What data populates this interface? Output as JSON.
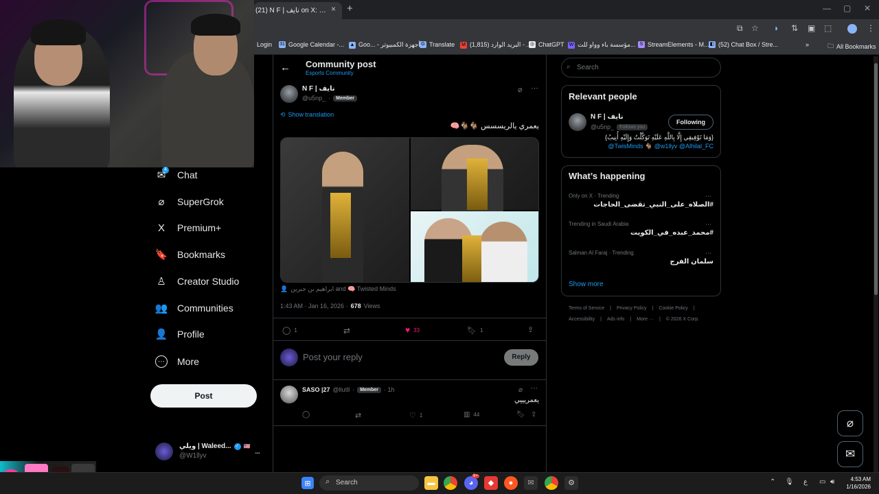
{
  "browser": {
    "tab_title": "(21) N F | نايف on X: \"الريسسس",
    "tab_close": "×",
    "new_tab": "+",
    "bookmarks": [
      {
        "label": "Login",
        "icon": ""
      },
      {
        "label": "Google Calendar -...",
        "icon": "31"
      },
      {
        "label": "Goo... - أجهزة الكمبيوتر",
        "icon": "▲"
      },
      {
        "label": "Translate",
        "icon": "G"
      },
      {
        "label": "البريد الوارد (1,815) - ...",
        "icon": "M"
      },
      {
        "label": "ChatGPT",
        "icon": "◎"
      },
      {
        "label": "مؤسسة باء وواو للت...",
        "icon": "W"
      },
      {
        "label": "StreamElements - M...",
        "icon": "S"
      },
      {
        "label": "(52) Chat Box / Stre...",
        "icon": "◧"
      }
    ],
    "more_bookmarks": "»",
    "all_bookmarks": "All Bookmarks"
  },
  "nav": {
    "chat_badge": "4",
    "items": [
      {
        "label": "Chat",
        "icon": "✉"
      },
      {
        "label": "SuperGrok",
        "icon": "⌀"
      },
      {
        "label": "Premium+",
        "icon": "X"
      },
      {
        "label": "Bookmarks",
        "icon": "🔖"
      },
      {
        "label": "Creator Studio",
        "icon": "♙"
      },
      {
        "label": "Communities",
        "icon": "👥"
      },
      {
        "label": "Profile",
        "icon": "👤"
      },
      {
        "label": "More",
        "icon": "⋯"
      }
    ],
    "post_button": "Post",
    "account": {
      "name": "ويلي | Waleed...",
      "handle": "@W1llyv",
      "more": "..."
    }
  },
  "post": {
    "header_title": "Community post",
    "header_subtitle": "Esports Community",
    "author_name": "N F | نايف",
    "author_handle": "@u5np_",
    "dot": "·",
    "member_badge": "Member",
    "show_translation": "Show translation",
    "text": "يعمري يالريسسس 🐐🐐🧠",
    "tagged": "ابراهيم بن جبرين and 🧠 Twisted Minds",
    "timestamp": "1:43 AM · Jan 16, 2026 ·",
    "views_count": "678",
    "views_label": "Views",
    "replies": "1",
    "likes": "33",
    "bookmarks": "1",
    "reply_placeholder": "Post your reply",
    "reply_button": "Reply"
  },
  "reply": {
    "name": "SASO |27",
    "handle": "@llutll",
    "badge": "Member",
    "time": "· 1h",
    "text": "يعمريييي",
    "likes": "1",
    "views": "44"
  },
  "sidebar": {
    "search_placeholder": "Search",
    "relevant_title": "Relevant people",
    "person_name": "N F | نايف",
    "person_handle": "@u5np_",
    "follows_you": "Follows you",
    "following_button": "Following",
    "bio_text": "{وَمَا تَوْفِيقِي إِلَّا بِاللَّهِ عَلَيْهِ تَوَكَّلْتُ وَإِلَيْهِ أُنِيبُ}",
    "bio_links": "@TwisMinds 🐐 @w1llyv @Alhilal_FC",
    "happening_title": "What’s happening",
    "trends": [
      {
        "meta": "Only on X · Trending",
        "name": "#الصلاه_على_النبي_تقضى_الحاجات"
      },
      {
        "meta": "Trending in Saudi Arabia",
        "name": "#محمد_عبده_في_الكويت"
      },
      {
        "meta": "Salman Al Faraj · Trending",
        "name": "سلمان الفرج"
      }
    ],
    "show_more": "Show more",
    "footer_row1": [
      "Terms of Service",
      "Privacy Policy",
      "Cookie Policy"
    ],
    "footer_row2": [
      "Accessibility",
      "Ads info",
      "More ···",
      "© 2026 X Corp."
    ]
  },
  "taskbar": {
    "search": "Search",
    "time": "4:53 AM",
    "date": "1/16/2026",
    "lang": "ع",
    "chrome_badge": "9+"
  },
  "colors": {
    "accent": "#1d9bf0",
    "like": "#f91880",
    "bg": "#000000"
  }
}
